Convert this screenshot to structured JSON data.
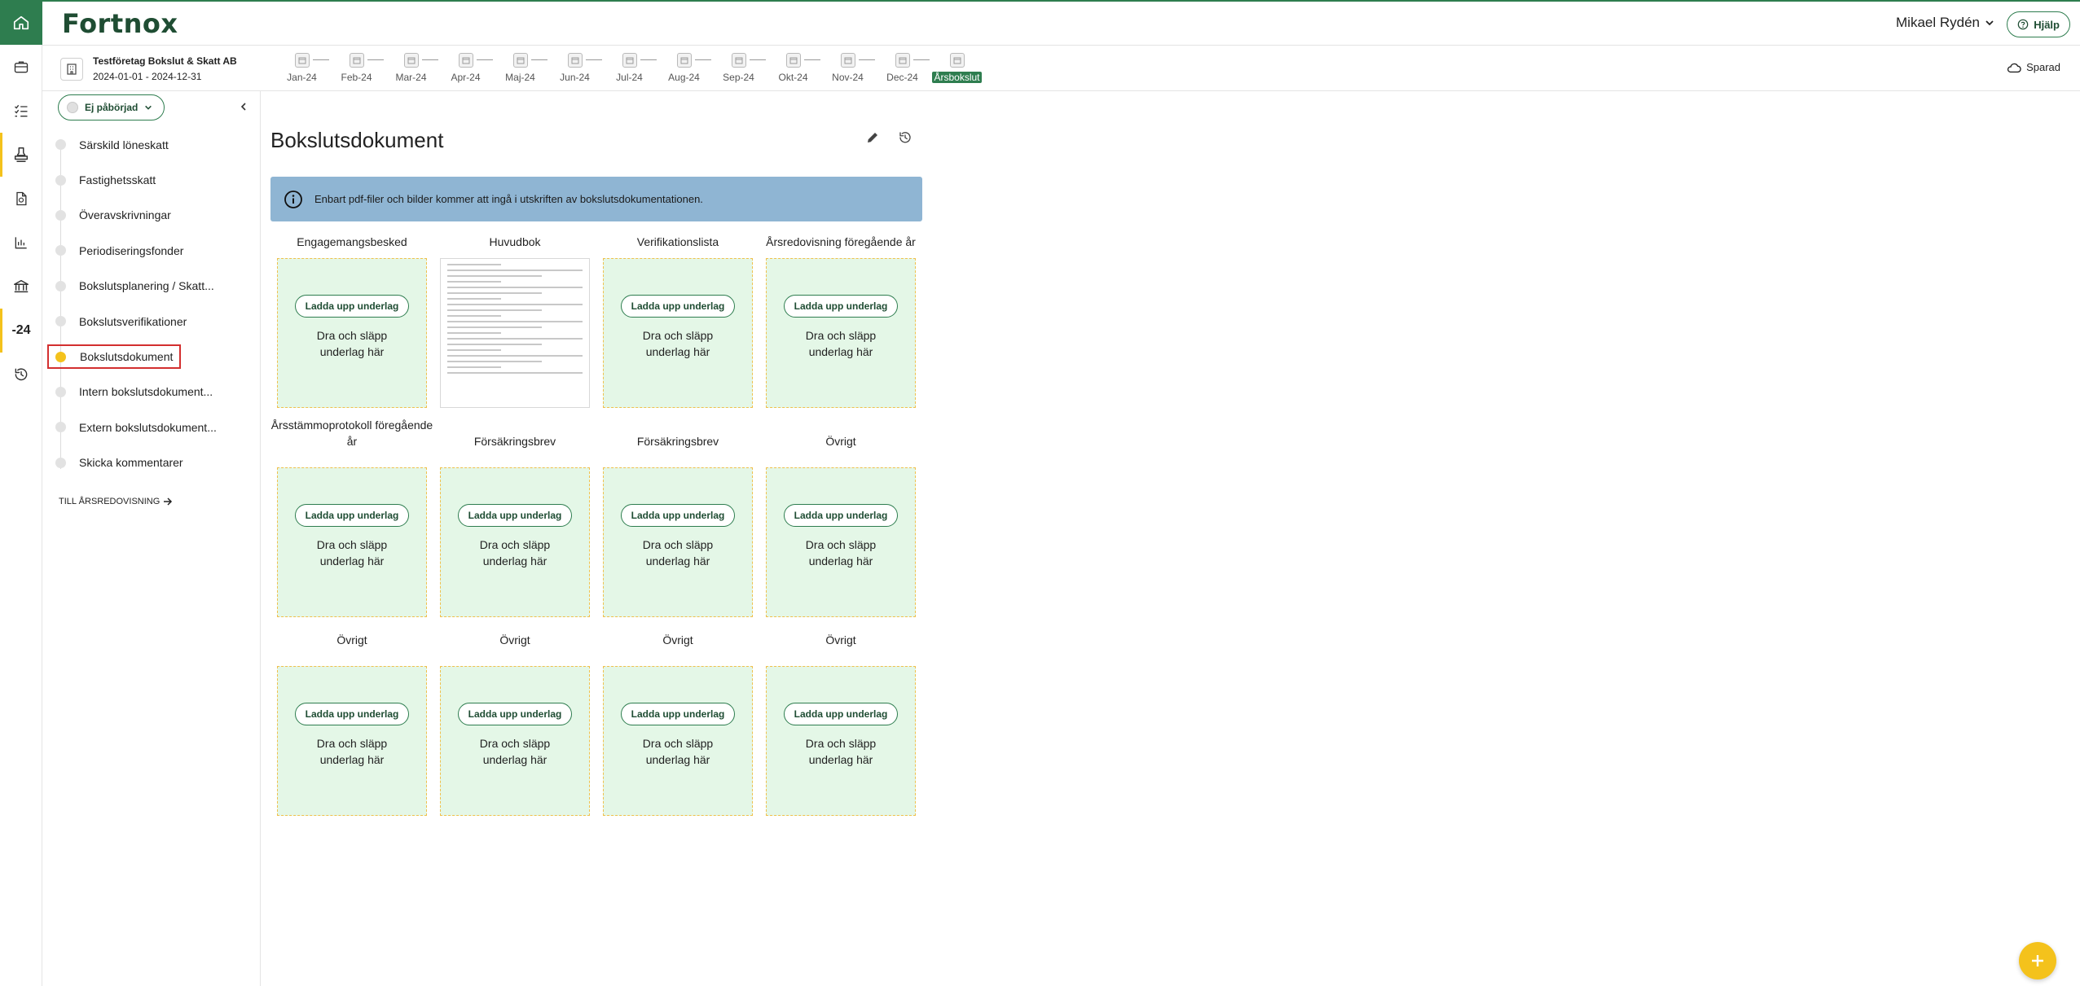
{
  "app": {
    "brand": "Fortnox"
  },
  "rail": {
    "items": [
      {
        "icon": "home-icon"
      },
      {
        "icon": "briefcase-icon"
      },
      {
        "icon": "checklist-icon"
      },
      {
        "icon": "stamp-icon",
        "active": true
      },
      {
        "icon": "document-icon"
      },
      {
        "icon": "bar-chart-icon"
      },
      {
        "icon": "bank-icon"
      },
      {
        "icon": "year-label",
        "label": "-24"
      },
      {
        "icon": "history-icon"
      }
    ]
  },
  "header": {
    "user_name": "Mikael Rydén",
    "help_label": "Hjälp"
  },
  "subbar": {
    "company_name": "Testföretag Bokslut & Skatt AB",
    "period": "2024-01-01 - 2024-12-31",
    "months": [
      "Jan-24",
      "Feb-24",
      "Mar-24",
      "Apr-24",
      "Maj-24",
      "Jun-24",
      "Jul-24",
      "Aug-24",
      "Sep-24",
      "Okt-24",
      "Nov-24",
      "Dec-24",
      "Årsbokslut"
    ],
    "current_month_index": 12,
    "saved_label": "Sparad"
  },
  "nav": {
    "status_label": "Ej påbörjad",
    "steps": [
      {
        "label": "Särskild löneskatt"
      },
      {
        "label": "Fastighetsskatt"
      },
      {
        "label": "Överavskrivningar"
      },
      {
        "label": "Periodiseringsfonder"
      },
      {
        "label": "Bokslutsplanering / Skatt..."
      },
      {
        "label": "Bokslutsverifikationer"
      },
      {
        "label": "Bokslutsdokument",
        "active": true
      },
      {
        "label": "Intern bokslutsdokument..."
      },
      {
        "label": "Extern bokslutsdokument..."
      },
      {
        "label": "Skicka kommentarer"
      }
    ],
    "to_annual_label": "TILL ÅRSREDOVISNING"
  },
  "main": {
    "title": "Bokslutsdokument",
    "info_text": "Enbart pdf-filer och bilder kommer att ingå i utskriften av bokslutsdokumentationen.",
    "upload_label": "Ladda upp underlag",
    "drop_text": "Dra och släpp underlag här",
    "cards": [
      {
        "title": "Engagemangsbesked",
        "has_file": false
      },
      {
        "title": "Huvudbok",
        "has_file": true
      },
      {
        "title": "Verifikationslista",
        "has_file": false
      },
      {
        "title": "Årsredovisning föregående år",
        "has_file": false
      },
      {
        "title": "Årsstämmoprotokoll föregående år",
        "has_file": false
      },
      {
        "title": "Försäkringsbrev",
        "has_file": false
      },
      {
        "title": "Försäkringsbrev",
        "has_file": false
      },
      {
        "title": "Övrigt",
        "has_file": false
      },
      {
        "title": "Övrigt",
        "has_file": false
      },
      {
        "title": "Övrigt",
        "has_file": false
      },
      {
        "title": "Övrigt",
        "has_file": false
      },
      {
        "title": "Övrigt",
        "has_file": false
      }
    ]
  },
  "colors": {
    "brand_green": "#2e7d4f",
    "accent_yellow": "#f4c21c",
    "info_blue": "#8fb5d3",
    "drop_bg": "#e4f7e7"
  }
}
